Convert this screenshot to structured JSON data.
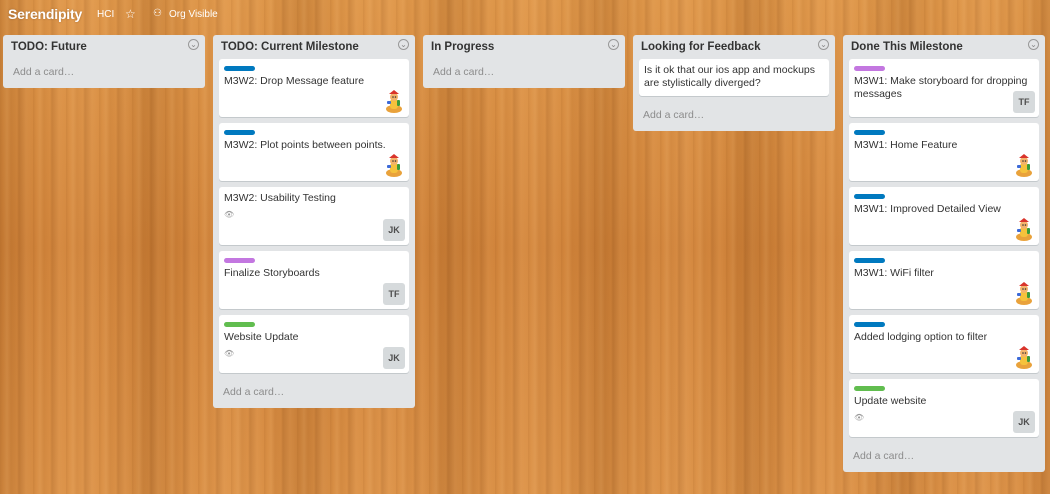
{
  "header": {
    "board_title": "Serendipity",
    "org": "HCI",
    "star_icon": "star-icon",
    "visibility_icon": "org-visibility-icon",
    "visibility": "Org Visible"
  },
  "label_colors": {
    "blue": "#0079bf",
    "purple": "#c377e0",
    "green": "#61bd4f"
  },
  "lists": [
    {
      "title": "TODO: Future",
      "add_card": "Add a card…",
      "cards": []
    },
    {
      "title": "TODO: Current Milestone",
      "add_card": "Add a card…",
      "cards": [
        {
          "label": "blue",
          "title": "M3W2: Drop Message feature",
          "member": "avatar"
        },
        {
          "label": "blue",
          "title": "M3W2: Plot points between points.",
          "member": "avatar"
        },
        {
          "label": "",
          "title": "M3W2: Usability Testing",
          "badge": "eye-icon",
          "member": "JK"
        },
        {
          "label": "purple",
          "title": "Finalize Storyboards",
          "member": "TF"
        },
        {
          "label": "green",
          "title": "Website Update",
          "badge": "eye-icon",
          "member": "JK"
        }
      ]
    },
    {
      "title": "In Progress",
      "add_card": "Add a card…",
      "cards": []
    },
    {
      "title": "Looking for Feedback",
      "add_card": "Add a card…",
      "cards": [
        {
          "label": "",
          "title": "Is it ok that our ios app and mockups are stylistically diverged?"
        }
      ]
    },
    {
      "title": "Done This Milestone",
      "add_card": "Add a card…",
      "cards": [
        {
          "label": "purple",
          "title": "M3W1: Make storyboard for dropping messages",
          "member": "TF"
        },
        {
          "label": "blue",
          "title": "M3W1: Home Feature",
          "member": "avatar"
        },
        {
          "label": "blue",
          "title": "M3W1: Improved Detailed View",
          "member": "avatar"
        },
        {
          "label": "blue",
          "title": "M3W1: WiFi filter",
          "member": "avatar"
        },
        {
          "label": "blue",
          "title": "Added lodging option to filter",
          "member": "avatar"
        },
        {
          "label": "green",
          "title": "Update website",
          "badge": "eye-icon",
          "member": "JK"
        }
      ]
    }
  ]
}
